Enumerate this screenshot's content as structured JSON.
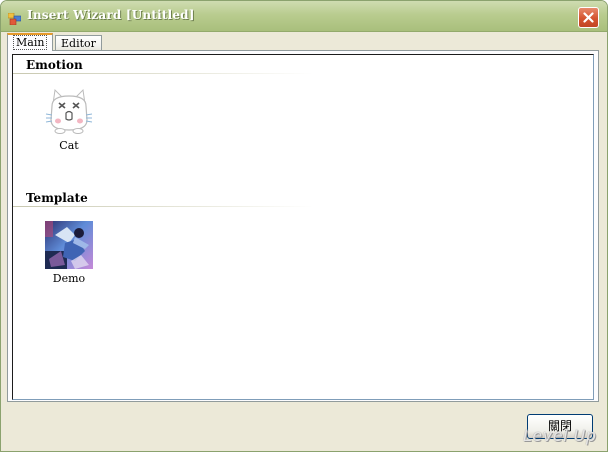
{
  "window": {
    "title": "Insert Wizard [Untitled]",
    "close_icon": "close-icon",
    "app_icon": "app-icon"
  },
  "tabs": [
    {
      "label": "Main",
      "active": true
    },
    {
      "label": "Editor",
      "active": false
    }
  ],
  "groups": [
    {
      "header": "Emotion",
      "items": [
        {
          "label": "Cat",
          "icon": "cat-face-icon"
        }
      ]
    },
    {
      "header": "Template",
      "items": [
        {
          "label": "Demo",
          "icon": "demo-thumbnail"
        }
      ]
    }
  ],
  "footer": {
    "close_label": "關閉"
  },
  "watermark": "Level Up",
  "colors": {
    "titlebar": "#b9cc8f",
    "close_button": "#d4542f",
    "active_tab_accent": "#e69a2b",
    "window_bg": "#ece9d8"
  }
}
